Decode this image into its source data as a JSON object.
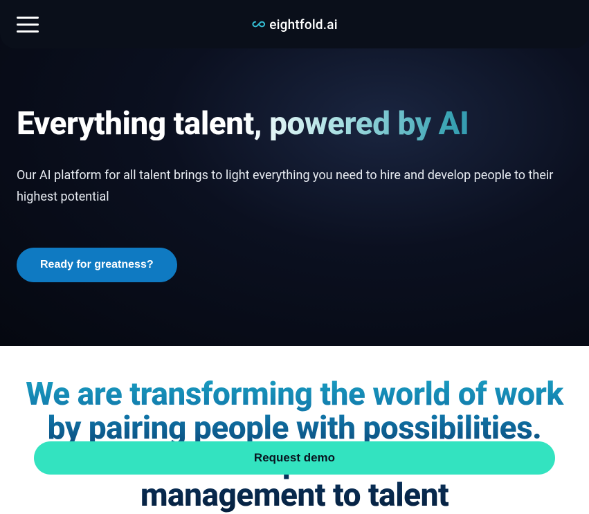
{
  "header": {
    "brand_text": "eightfold.ai"
  },
  "hero": {
    "title": "Everything talent, powered by AI",
    "subtitle": "Our AI platform for all talent brings to light everything you need to hire and develop people to their highest potential",
    "cta_label": "Ready for greatness?"
  },
  "section_two": {
    "title": "We are transforming the world of work by pairing people with possibilities. From talent acquisition to talent management to talent"
  },
  "footer_cta": {
    "label": "Request demo"
  },
  "colors": {
    "accent_blue": "#0f7ac2",
    "accent_teal": "#33e3c0",
    "dark_bg": "#0a0f1a"
  }
}
